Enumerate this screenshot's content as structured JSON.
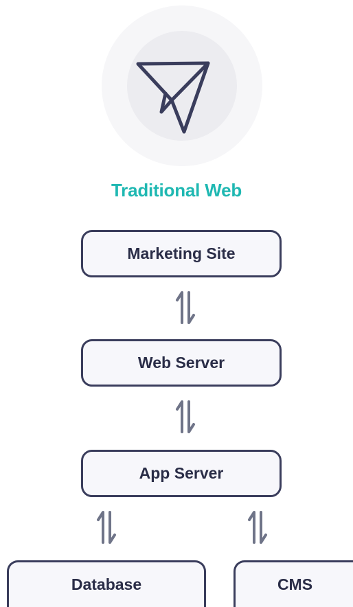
{
  "diagram": {
    "title": "Traditional Web",
    "icon": "paper-plane-icon",
    "nodes": {
      "marketing_site": "Marketing Site",
      "web_server": "Web Server",
      "app_server": "App Server",
      "database": "Database",
      "cms": "CMS"
    },
    "edges": [
      {
        "from": "Marketing Site",
        "to": "Web Server",
        "direction": "bidirectional"
      },
      {
        "from": "Web Server",
        "to": "App Server",
        "direction": "bidirectional"
      },
      {
        "from": "App Server",
        "to": "Database",
        "direction": "bidirectional"
      },
      {
        "from": "App Server",
        "to": "CMS",
        "direction": "bidirectional"
      }
    ],
    "colors": {
      "accent": "#1fb8b2",
      "box_border": "#3a3d5c",
      "arrow": "#6f7488"
    }
  }
}
